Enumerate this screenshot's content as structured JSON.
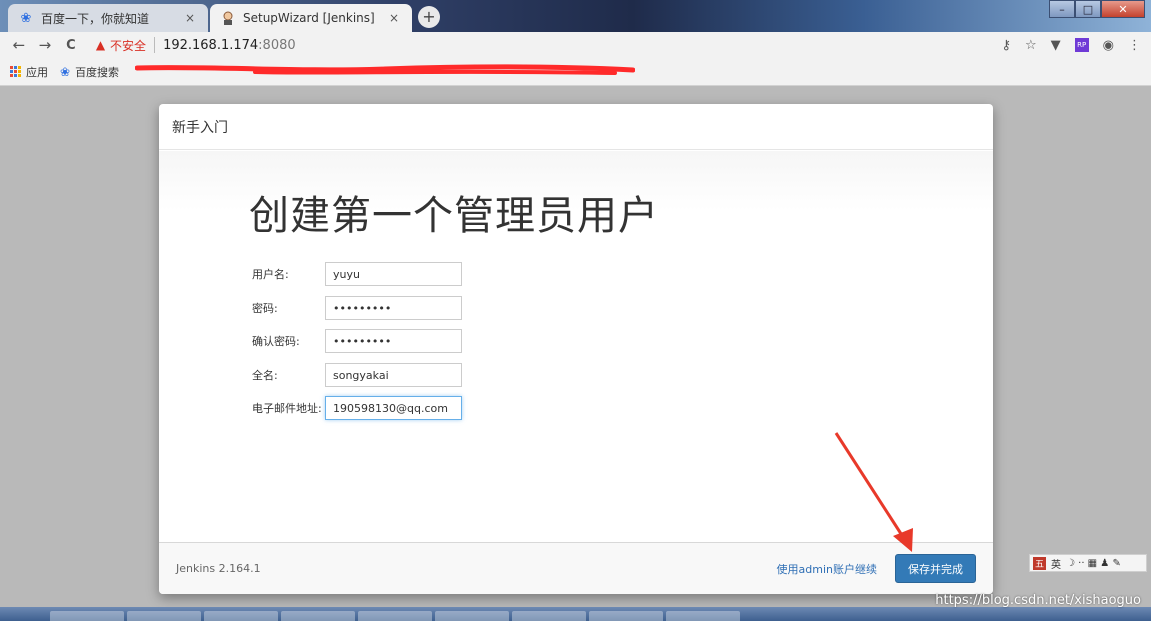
{
  "tabs": [
    {
      "title": "百度一下，你就知道",
      "icon": "baidu-paw-icon",
      "close": "×",
      "active": false
    },
    {
      "title": "SetupWizard [Jenkins]",
      "icon": "jenkins-icon",
      "close": "×",
      "active": true
    }
  ],
  "new_tab": "+",
  "window_controls": {
    "minimize": "–",
    "maximize": "□",
    "close": "✕"
  },
  "toolbar": {
    "back": "←",
    "forward": "→",
    "reload": "C",
    "security_warning": "不安全",
    "host": "192.168.1.174",
    "port": ":8080"
  },
  "bookmarks": [
    {
      "label": "应用",
      "icon": "apps-grid-icon"
    },
    {
      "label": "百度搜索",
      "icon": "baidu-paw-icon"
    }
  ],
  "dialog": {
    "header": "新手入门",
    "title": "创建第一个管理员用户",
    "fields": [
      {
        "label": "用户名:",
        "value": "yuyu",
        "type": "text"
      },
      {
        "label": "密码:",
        "value": "123456789",
        "type": "password"
      },
      {
        "label": "确认密码:",
        "value": "123456789",
        "type": "password"
      },
      {
        "label": "全名:",
        "value": "songyakai",
        "type": "text"
      },
      {
        "label": "电子邮件地址:",
        "value": "190598130@qq.com",
        "type": "text"
      }
    ],
    "footer": {
      "version": "Jenkins 2.164.1",
      "continue_as_admin": "使用admin账户继续",
      "save_button": "保存并完成"
    }
  },
  "ime_bar": {
    "logo": "五",
    "mode": "英",
    "extra": "☽ ·· ▦ ♟ ✎"
  },
  "watermark": "https://blog.csdn.net/xishaoguo",
  "colors": {
    "primary_button": "#337ab7",
    "link": "#2f6fb5",
    "warning": "#d93025",
    "annotation_arrow": "#e8392a"
  }
}
